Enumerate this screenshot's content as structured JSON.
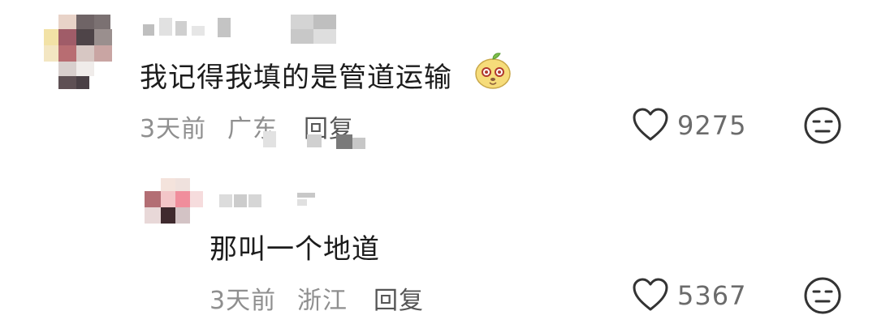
{
  "comments": [
    {
      "text": "我记得我填的是管道运输",
      "emoji_icon": "smiling-face-emoji-icon",
      "time": "3天前",
      "location": "广东",
      "reply_label": "回复",
      "like_count": "9275"
    },
    {
      "text": "那叫一个地道",
      "time": "3天前",
      "location": "浙江",
      "reply_label": "回复",
      "like_count": "5367"
    }
  ],
  "icons": {
    "like": "heart-outline-icon",
    "dislike": "unamused-face-icon"
  },
  "colors": {
    "text": "#1c1c1c",
    "meta": "#8f8f8f",
    "icon": "#333333"
  }
}
